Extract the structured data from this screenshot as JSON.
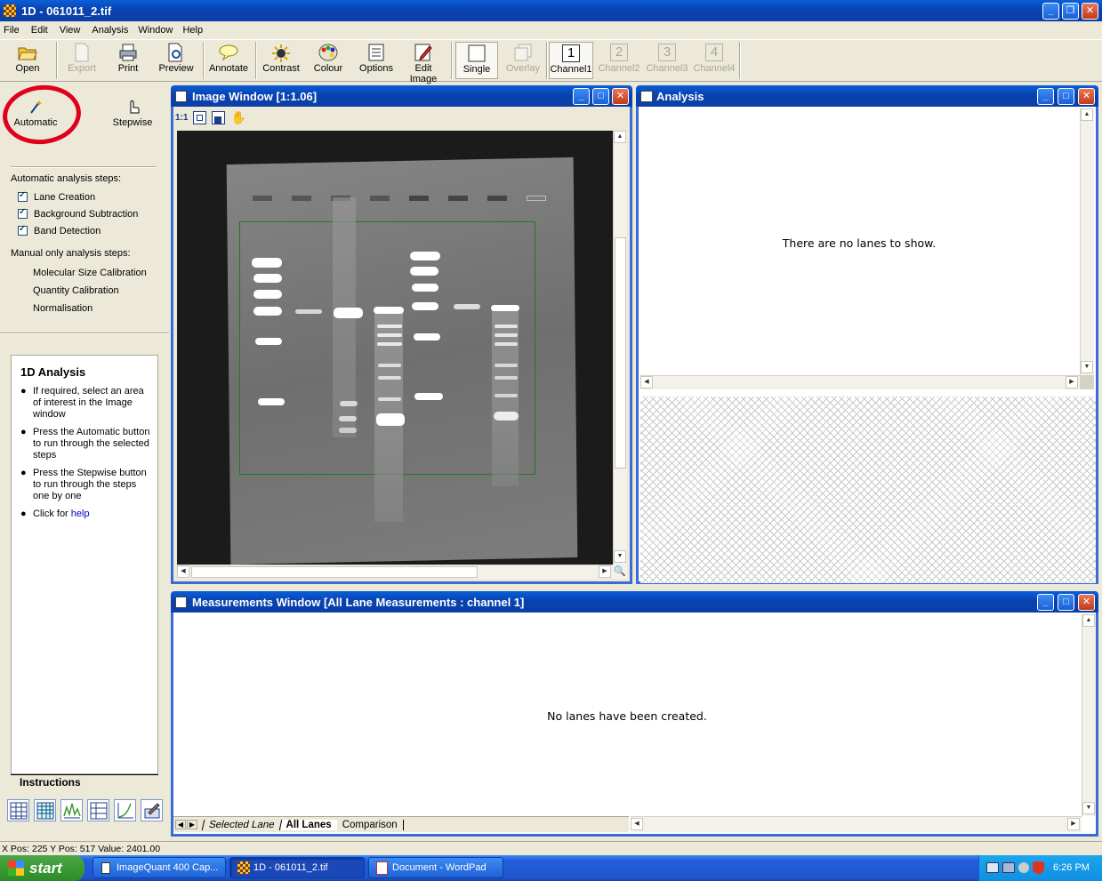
{
  "app": {
    "title": "1D - 061011_2.tif"
  },
  "menu": [
    "File",
    "Edit",
    "View",
    "Analysis",
    "Window",
    "Help"
  ],
  "toolbar": {
    "open": "Open",
    "export": "Export",
    "print": "Print",
    "preview": "Preview",
    "annotate": "Annotate",
    "contrast": "Contrast",
    "colour": "Colour",
    "options": "Options",
    "edit_image": "Edit Image",
    "single": "Single",
    "overlay": "Overlay",
    "channel1": "Channel1",
    "channel2": "Channel2",
    "channel3": "Channel3",
    "channel4": "Channel4",
    "ch1_num": "1",
    "ch2_num": "2",
    "ch3_num": "3",
    "ch4_num": "4"
  },
  "side": {
    "automatic": "Automatic",
    "stepwise": "Stepwise",
    "auto_steps_heading": "Automatic analysis steps:",
    "auto_steps": [
      "Lane Creation",
      "Background Subtraction",
      "Band Detection"
    ],
    "manual_heading": "Manual only analysis steps:",
    "manual_steps": [
      "Molecular Size Calibration",
      "Quantity Calibration",
      "Normalisation"
    ],
    "instructions_title": "1D Analysis",
    "instructions": [
      "If required, select an area of interest in the Image window",
      "Press the Automatic button to run through the selected steps",
      "Press the Stepwise button to run through the steps one by one"
    ],
    "help_prefix": "Click for ",
    "help_link": "help",
    "tab_label": "Instructions"
  },
  "image_window": {
    "title": "Image Window [1:1.06]",
    "zoom_tool": "1:1"
  },
  "analysis_window": {
    "title": "Analysis",
    "empty": "There are no lanes to show."
  },
  "measure_window": {
    "title": "Measurements Window [All Lane Measurements : channel 1]",
    "empty": "No lanes have been created.",
    "tabs": [
      "Selected Lane",
      "All Lanes",
      "Comparison"
    ]
  },
  "status": {
    "text": "X Pos: 225 Y Pos: 517 Value: 2401.00"
  },
  "taskbar": {
    "start": "start",
    "items": [
      "ImageQuant 400 Cap...",
      "1D - 061011_2.tif",
      "Document - WordPad"
    ],
    "clock": "6:26 PM"
  },
  "colors": {
    "title_blue": "#0842b0",
    "highlight_circle": "#e0001b",
    "xp_green": "#3c9a35"
  }
}
